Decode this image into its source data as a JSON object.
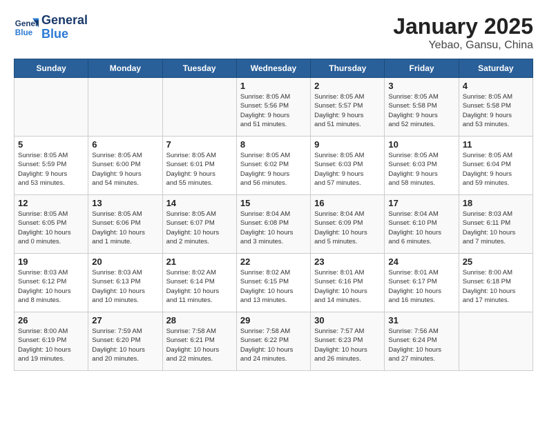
{
  "logo": {
    "line1": "General",
    "line2": "Blue"
  },
  "title": "January 2025",
  "subtitle": "Yebao, Gansu, China",
  "headers": [
    "Sunday",
    "Monday",
    "Tuesday",
    "Wednesday",
    "Thursday",
    "Friday",
    "Saturday"
  ],
  "weeks": [
    [
      {
        "day": "",
        "info": ""
      },
      {
        "day": "",
        "info": ""
      },
      {
        "day": "",
        "info": ""
      },
      {
        "day": "1",
        "info": "Sunrise: 8:05 AM\nSunset: 5:56 PM\nDaylight: 9 hours\nand 51 minutes."
      },
      {
        "day": "2",
        "info": "Sunrise: 8:05 AM\nSunset: 5:57 PM\nDaylight: 9 hours\nand 51 minutes."
      },
      {
        "day": "3",
        "info": "Sunrise: 8:05 AM\nSunset: 5:58 PM\nDaylight: 9 hours\nand 52 minutes."
      },
      {
        "day": "4",
        "info": "Sunrise: 8:05 AM\nSunset: 5:58 PM\nDaylight: 9 hours\nand 53 minutes."
      }
    ],
    [
      {
        "day": "5",
        "info": "Sunrise: 8:05 AM\nSunset: 5:59 PM\nDaylight: 9 hours\nand 53 minutes."
      },
      {
        "day": "6",
        "info": "Sunrise: 8:05 AM\nSunset: 6:00 PM\nDaylight: 9 hours\nand 54 minutes."
      },
      {
        "day": "7",
        "info": "Sunrise: 8:05 AM\nSunset: 6:01 PM\nDaylight: 9 hours\nand 55 minutes."
      },
      {
        "day": "8",
        "info": "Sunrise: 8:05 AM\nSunset: 6:02 PM\nDaylight: 9 hours\nand 56 minutes."
      },
      {
        "day": "9",
        "info": "Sunrise: 8:05 AM\nSunset: 6:03 PM\nDaylight: 9 hours\nand 57 minutes."
      },
      {
        "day": "10",
        "info": "Sunrise: 8:05 AM\nSunset: 6:03 PM\nDaylight: 9 hours\nand 58 minutes."
      },
      {
        "day": "11",
        "info": "Sunrise: 8:05 AM\nSunset: 6:04 PM\nDaylight: 9 hours\nand 59 minutes."
      }
    ],
    [
      {
        "day": "12",
        "info": "Sunrise: 8:05 AM\nSunset: 6:05 PM\nDaylight: 10 hours\nand 0 minutes."
      },
      {
        "day": "13",
        "info": "Sunrise: 8:05 AM\nSunset: 6:06 PM\nDaylight: 10 hours\nand 1 minute."
      },
      {
        "day": "14",
        "info": "Sunrise: 8:05 AM\nSunset: 6:07 PM\nDaylight: 10 hours\nand 2 minutes."
      },
      {
        "day": "15",
        "info": "Sunrise: 8:04 AM\nSunset: 6:08 PM\nDaylight: 10 hours\nand 3 minutes."
      },
      {
        "day": "16",
        "info": "Sunrise: 8:04 AM\nSunset: 6:09 PM\nDaylight: 10 hours\nand 5 minutes."
      },
      {
        "day": "17",
        "info": "Sunrise: 8:04 AM\nSunset: 6:10 PM\nDaylight: 10 hours\nand 6 minutes."
      },
      {
        "day": "18",
        "info": "Sunrise: 8:03 AM\nSunset: 6:11 PM\nDaylight: 10 hours\nand 7 minutes."
      }
    ],
    [
      {
        "day": "19",
        "info": "Sunrise: 8:03 AM\nSunset: 6:12 PM\nDaylight: 10 hours\nand 8 minutes."
      },
      {
        "day": "20",
        "info": "Sunrise: 8:03 AM\nSunset: 6:13 PM\nDaylight: 10 hours\nand 10 minutes."
      },
      {
        "day": "21",
        "info": "Sunrise: 8:02 AM\nSunset: 6:14 PM\nDaylight: 10 hours\nand 11 minutes."
      },
      {
        "day": "22",
        "info": "Sunrise: 8:02 AM\nSunset: 6:15 PM\nDaylight: 10 hours\nand 13 minutes."
      },
      {
        "day": "23",
        "info": "Sunrise: 8:01 AM\nSunset: 6:16 PM\nDaylight: 10 hours\nand 14 minutes."
      },
      {
        "day": "24",
        "info": "Sunrise: 8:01 AM\nSunset: 6:17 PM\nDaylight: 10 hours\nand 16 minutes."
      },
      {
        "day": "25",
        "info": "Sunrise: 8:00 AM\nSunset: 6:18 PM\nDaylight: 10 hours\nand 17 minutes."
      }
    ],
    [
      {
        "day": "26",
        "info": "Sunrise: 8:00 AM\nSunset: 6:19 PM\nDaylight: 10 hours\nand 19 minutes."
      },
      {
        "day": "27",
        "info": "Sunrise: 7:59 AM\nSunset: 6:20 PM\nDaylight: 10 hours\nand 20 minutes."
      },
      {
        "day": "28",
        "info": "Sunrise: 7:58 AM\nSunset: 6:21 PM\nDaylight: 10 hours\nand 22 minutes."
      },
      {
        "day": "29",
        "info": "Sunrise: 7:58 AM\nSunset: 6:22 PM\nDaylight: 10 hours\nand 24 minutes."
      },
      {
        "day": "30",
        "info": "Sunrise: 7:57 AM\nSunset: 6:23 PM\nDaylight: 10 hours\nand 26 minutes."
      },
      {
        "day": "31",
        "info": "Sunrise: 7:56 AM\nSunset: 6:24 PM\nDaylight: 10 hours\nand 27 minutes."
      },
      {
        "day": "",
        "info": ""
      }
    ]
  ]
}
